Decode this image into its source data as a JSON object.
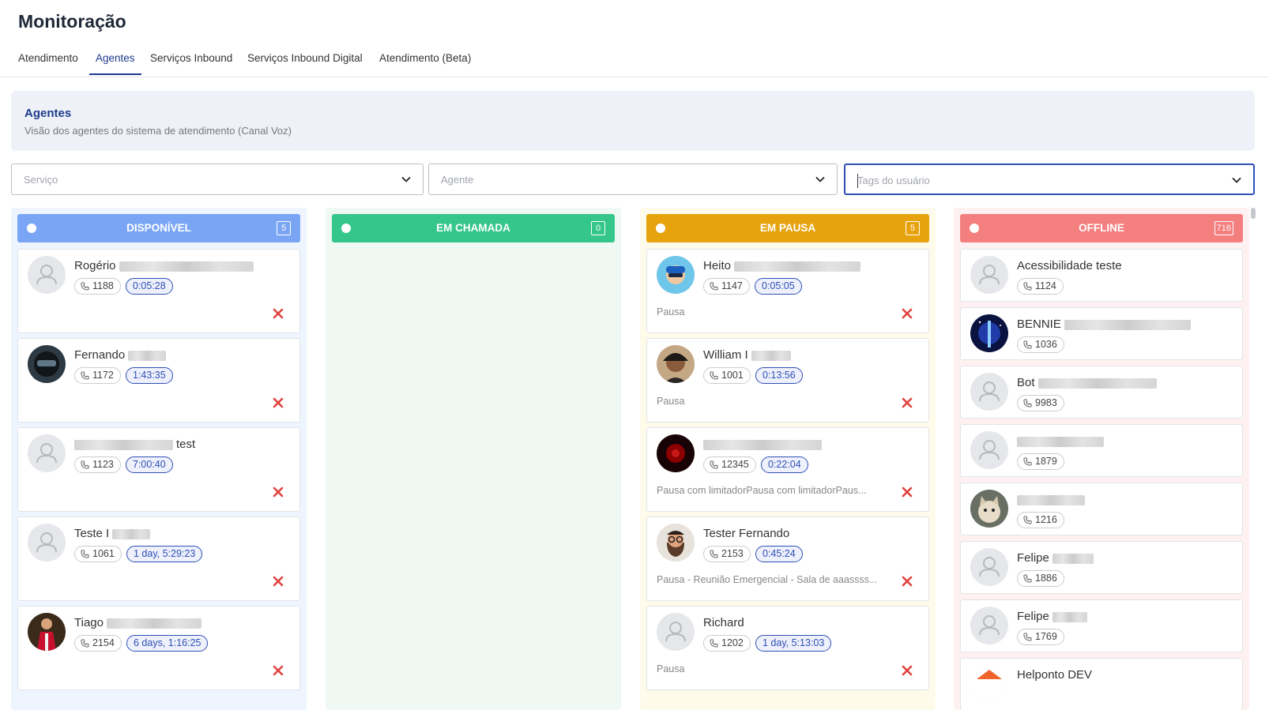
{
  "page": {
    "title": "Monitoração"
  },
  "tabs": [
    {
      "label": "Atendimento",
      "active": false
    },
    {
      "label": "Agentes",
      "active": true
    },
    {
      "label": "Serviços Inbound",
      "active": false
    },
    {
      "label": "Serviços Inbound Digital",
      "active": false
    },
    {
      "label": "Atendimento (Beta)",
      "active": false
    }
  ],
  "info": {
    "title": "Agentes",
    "subtitle": "Visão dos agentes do sistema de atendimento (Canal Voz)"
  },
  "filters": {
    "servico": {
      "placeholder": "Serviço"
    },
    "agente": {
      "placeholder": "Agente"
    },
    "tags": {
      "placeholder": "Tags do usuário"
    }
  },
  "colors": {
    "disponivel": "#7aa5f5",
    "em_chamada": "#34c68a",
    "em_pausa": "#e6a30e",
    "offline": "#f47f7f",
    "accent": "#2f4fb5"
  },
  "columns": [
    {
      "title": "DISPONÍVEL",
      "count": "5",
      "agents": [
        {
          "name": "Rogério",
          "ext": "1188",
          "time": "0:05:28",
          "status": ""
        },
        {
          "name": "Fernando",
          "ext": "1172",
          "time": "1:43:35",
          "status": ""
        },
        {
          "name": "test",
          "ext": "1123",
          "time": "7:00:40",
          "status": ""
        },
        {
          "name": "Teste I",
          "ext": "1061",
          "time": "1 day, 5:29:23",
          "status": ""
        },
        {
          "name": "Tiago",
          "ext": "2154",
          "time": "6 days, 1:16:25",
          "status": ""
        }
      ]
    },
    {
      "title": "EM CHAMADA",
      "count": "0",
      "agents": []
    },
    {
      "title": "EM PAUSA",
      "count": "5",
      "agents": [
        {
          "name": "Heito",
          "ext": "1147",
          "time": "0:05:05",
          "status": "Pausa"
        },
        {
          "name": "William I",
          "ext": "1001",
          "time": "0:13:56",
          "status": "Pausa"
        },
        {
          "name": "",
          "ext": "12345",
          "time": "0:22:04",
          "status": "Pausa com limitadorPausa com limitadorPaus..."
        },
        {
          "name": "Tester Fernando",
          "ext": "2153",
          "time": "0:45:24",
          "status": "Pausa - Reunião Emergencial - Sala de aaassss..."
        },
        {
          "name": "Richard",
          "ext": "1202",
          "time": "1 day, 5:13:03",
          "status": "Pausa"
        }
      ]
    },
    {
      "title": "OFFLINE",
      "count": "716",
      "agents": [
        {
          "name": "Acessibilidade teste",
          "ext": "1124"
        },
        {
          "name": "BENNIE",
          "ext": "1036"
        },
        {
          "name": "Bot",
          "ext": "9983"
        },
        {
          "name": "",
          "ext": "1879"
        },
        {
          "name": "",
          "ext": "1216"
        },
        {
          "name": "Felipe",
          "ext": "1886"
        },
        {
          "name": "Felipe",
          "ext": "1769"
        },
        {
          "name": "Helponto DEV",
          "ext": ""
        }
      ]
    }
  ]
}
